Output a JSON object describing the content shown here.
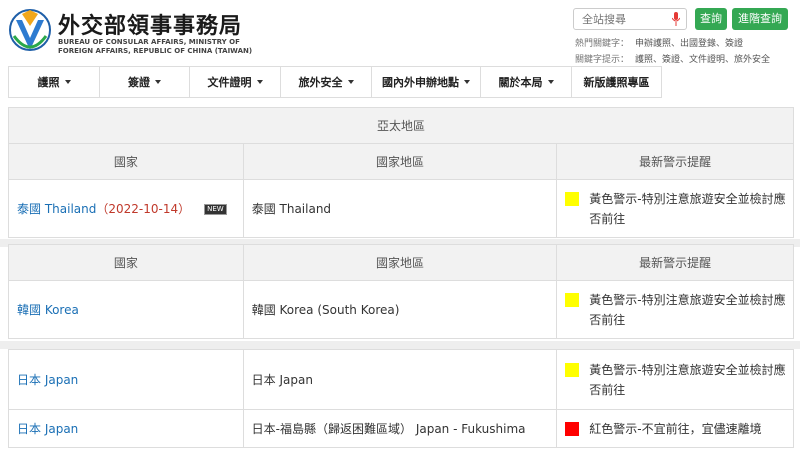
{
  "header": {
    "title_cn": "外交部領事事務局",
    "title_en": "BUREAU OF CONSULAR AFFAIRS, MINISTRY OF FOREIGN AFFAIRS, REPUBLIC OF CHINA (TAIWAN)",
    "search_placeholder": "全站搜尋",
    "search_button": "查詢",
    "advanced_search_button": "進階查詢",
    "hot_keywords_label": "熱門關鍵字：",
    "hot_keywords": "申辦護照、出國登錄、簽證",
    "hint_keywords_label": "關鍵字提示：",
    "hint_keywords": "護照、簽證、文件證明、旅外安全"
  },
  "nav": [
    {
      "label": "護照",
      "dropdown": true
    },
    {
      "label": "簽證",
      "dropdown": true
    },
    {
      "label": "文件證明",
      "dropdown": true
    },
    {
      "label": "旅外安全",
      "dropdown": true
    },
    {
      "label": "國內外申辦地點",
      "dropdown": true
    },
    {
      "label": "關於本局",
      "dropdown": true
    },
    {
      "label": "新版護照專區",
      "dropdown": false
    }
  ],
  "region_title": "亞太地區",
  "columns": {
    "country": "國家",
    "area": "國家地區",
    "alert": "最新警示提醒"
  },
  "rows": {
    "thailand": {
      "country": "泰國 Thailand",
      "date": "（2022-10-14）",
      "badge": "NEW",
      "area": "泰國 Thailand",
      "alert": "黃色警示-特別注意旅遊安全並檢討應否前往",
      "alert_color": "#ffff00"
    },
    "korea": {
      "country": "韓國 Korea",
      "area": "韓國 Korea (South Korea)",
      "alert": "黃色警示-特別注意旅遊安全並檢討應否前往",
      "alert_color": "#ffff00"
    },
    "japan": {
      "country": "日本 Japan",
      "area": "日本 Japan",
      "alert": "黃色警示-特別注意旅遊安全並檢討應否前往",
      "alert_color": "#ffff00"
    },
    "fukushima": {
      "country": "日本 Japan",
      "area": "日本-福島縣（歸返困難區域） Japan - Fukushima",
      "alert": "紅色警示-不宜前往，宜儘速離境",
      "alert_color": "#ff0000"
    }
  },
  "colors": {
    "accent_green": "#34a853",
    "link_blue": "#1a6fb5",
    "date_red": "#c0392b"
  }
}
